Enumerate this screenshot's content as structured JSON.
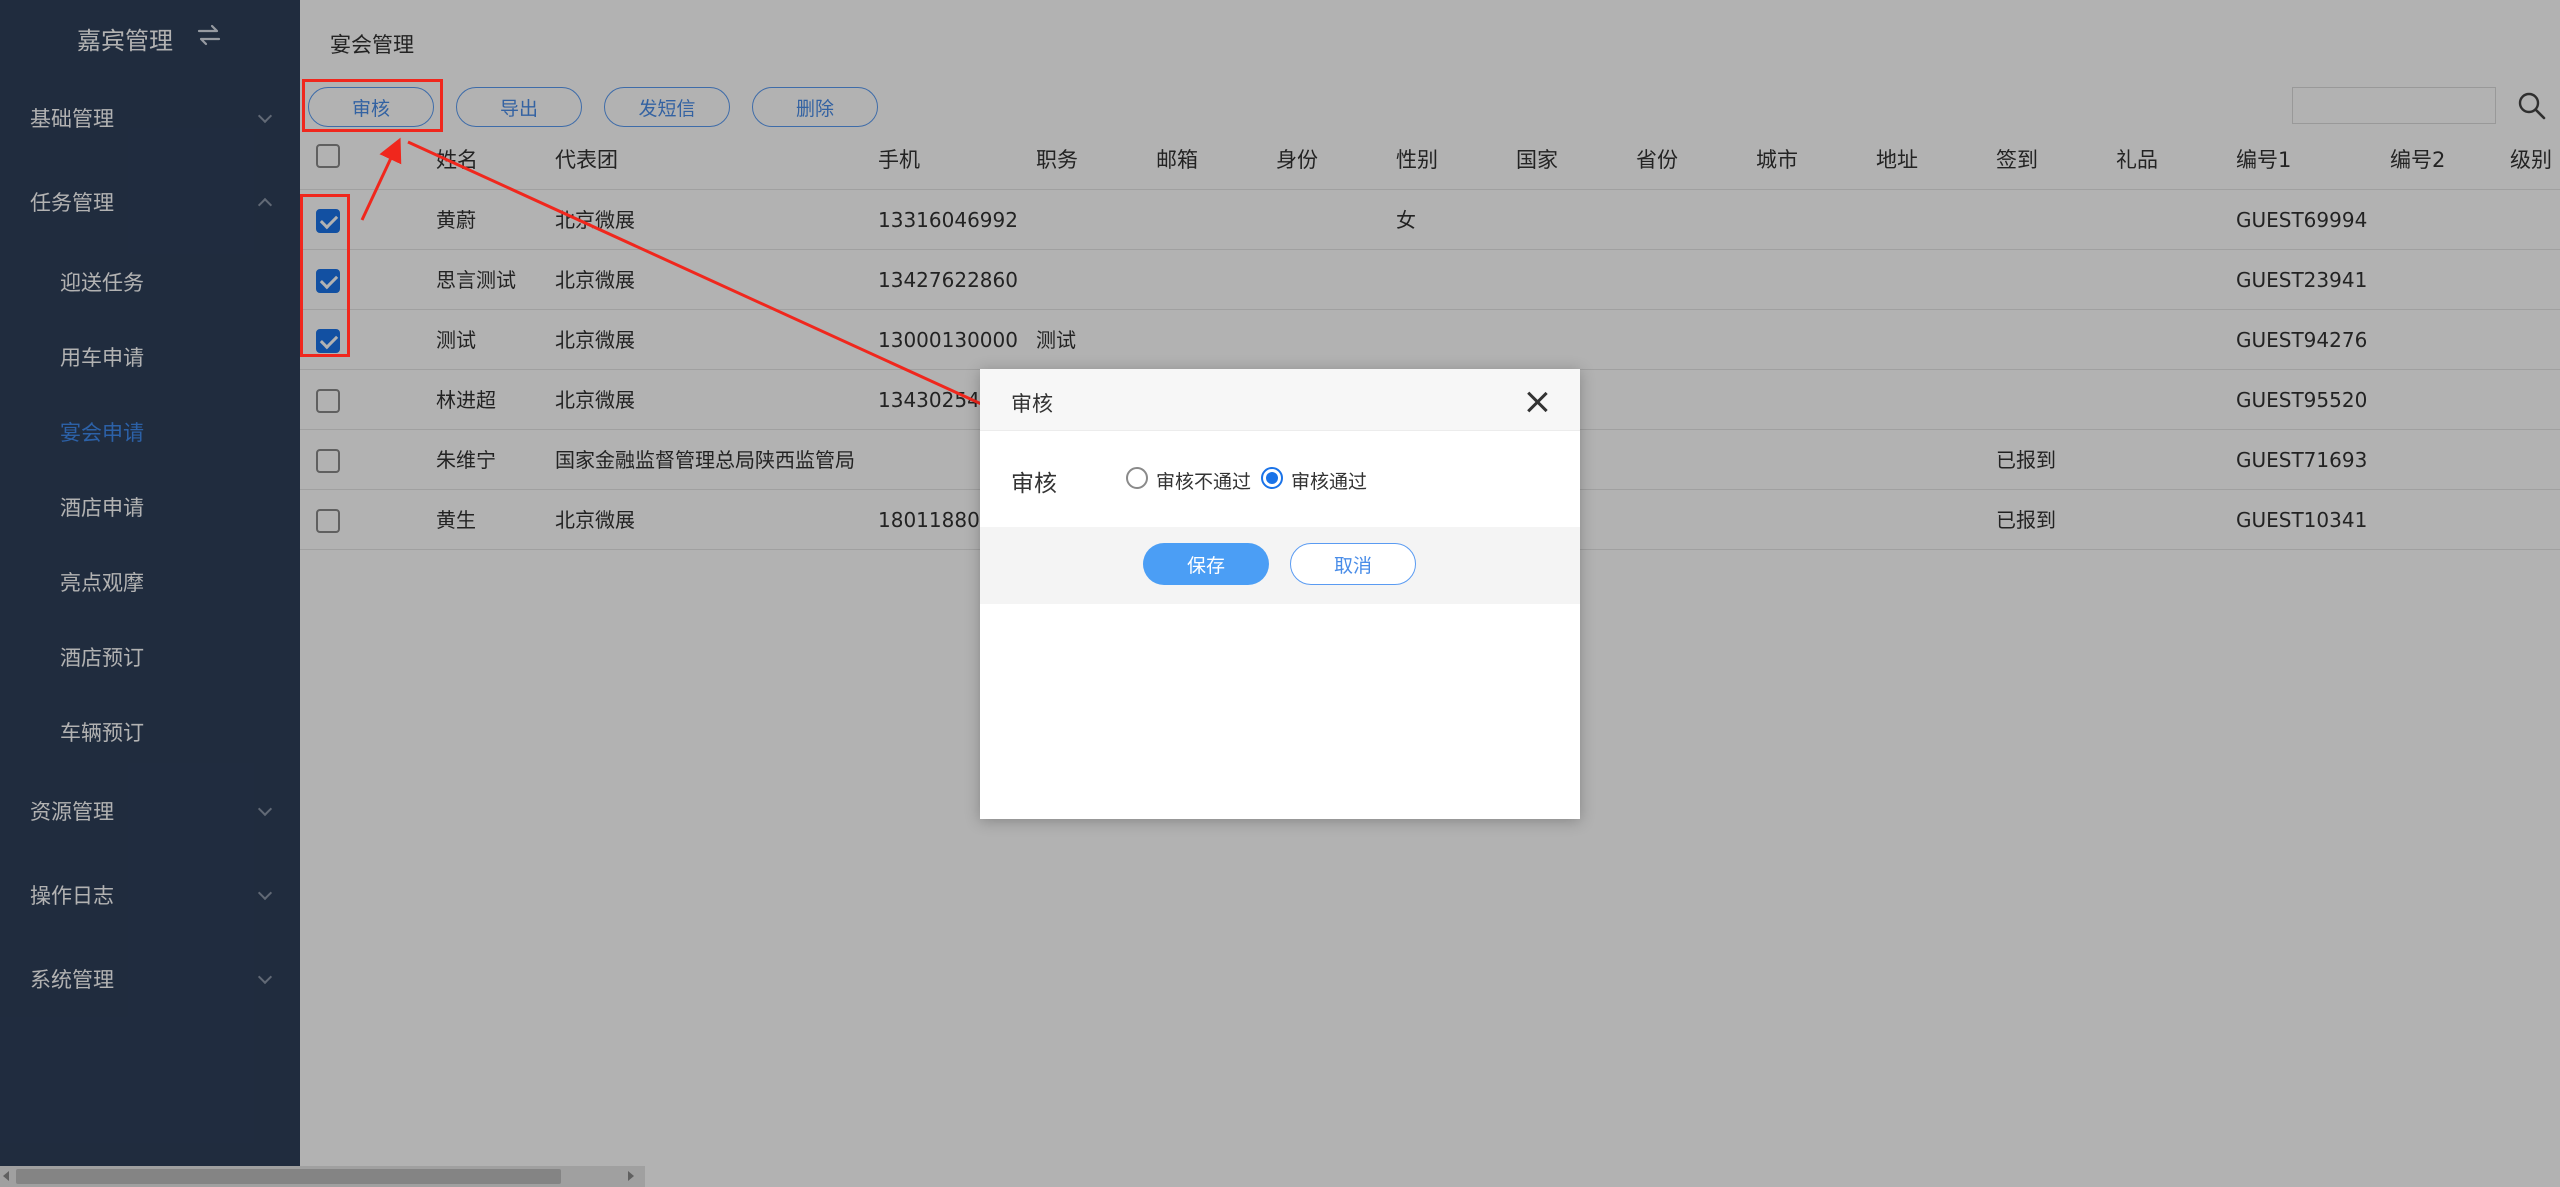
{
  "sidebar": {
    "title": "嘉宾管理",
    "swap_icon": "↻⇆",
    "groups": [
      {
        "label": "基础管理"
      },
      {
        "label": "任务管理"
      },
      {
        "label": "资源管理"
      },
      {
        "label": "操作日志"
      },
      {
        "label": "系统管理"
      }
    ],
    "task_items": [
      {
        "label": "迎送任务"
      },
      {
        "label": "用车申请"
      },
      {
        "label": "宴会申请"
      },
      {
        "label": "酒店申请"
      },
      {
        "label": "亮点观摩"
      },
      {
        "label": "酒店预订"
      },
      {
        "label": "车辆预订"
      }
    ],
    "active_item": "宴会申请"
  },
  "main": {
    "breadcrumb": "宴会管理",
    "toolbar": {
      "audit": "审核",
      "export": "导出",
      "sms": "发短信",
      "delete": "删除"
    },
    "search": {
      "value": "",
      "placeholder": ""
    },
    "columns": [
      "姓名",
      "代表团",
      "手机",
      "职务",
      "邮箱",
      "身份",
      "性别",
      "国家",
      "省份",
      "城市",
      "地址",
      "签到",
      "礼品",
      "编号1",
      "编号2",
      "级别"
    ],
    "rows": [
      {
        "checked": true,
        "name": "黄蔚",
        "delegation": "北京微展",
        "phone": "13316046992",
        "position": "",
        "gender": "女",
        "signin": "",
        "code1": "GUEST69994"
      },
      {
        "checked": true,
        "name": "思言测试",
        "delegation": "北京微展",
        "phone": "13427622860",
        "position": "",
        "gender": "",
        "signin": "",
        "code1": "GUEST23941"
      },
      {
        "checked": true,
        "name": "测试",
        "delegation": "北京微展",
        "phone": "13000130000",
        "position": "测试",
        "gender": "",
        "signin": "",
        "code1": "GUEST94276"
      },
      {
        "checked": false,
        "name": "林进超",
        "delegation": "北京微展",
        "phone": "134302540",
        "position": "",
        "gender": "",
        "signin": "",
        "code1": "GUEST95520"
      },
      {
        "checked": false,
        "name": "朱维宁",
        "delegation": "国家金融监督管理总局陕西监管局",
        "phone": "",
        "position": "",
        "gender": "",
        "signin": "已报到",
        "code1": "GUEST71693"
      },
      {
        "checked": false,
        "name": "黄生",
        "delegation": "北京微展",
        "phone": "180118800",
        "position": "",
        "gender": "",
        "signin": "已报到",
        "code1": "GUEST10341"
      }
    ]
  },
  "dialog": {
    "title": "审核",
    "field_label": "审核",
    "options": [
      {
        "label": "审核不通过",
        "selected": false
      },
      {
        "label": "审核通过",
        "selected": true
      }
    ],
    "save": "保存",
    "cancel": "取消"
  },
  "colors": {
    "sidebar_bg": "#2e3f5a",
    "accent": "#4b9ef5",
    "annotation": "#f0271d",
    "checkbox": "#1a73e8"
  }
}
